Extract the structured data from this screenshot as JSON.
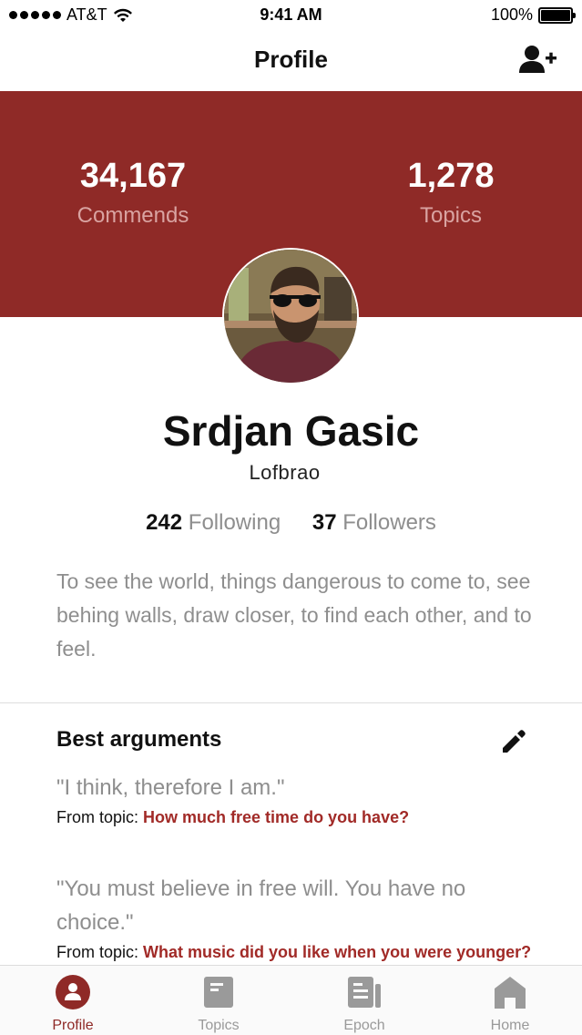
{
  "status_bar": {
    "carrier": "AT&T",
    "time": "9:41 AM",
    "battery": "100%",
    "battery_level": 1.0
  },
  "nav": {
    "title": "Profile",
    "action_icon": "add-user-icon"
  },
  "stats": {
    "commends_value": "34,167",
    "commends_label": "Commends",
    "topics_value": "1,278",
    "topics_label": "Topics"
  },
  "profile": {
    "name": "Srdjan Gasic",
    "username": "Lofbrao",
    "following_count": "242",
    "following_label": "Following",
    "followers_count": "37",
    "followers_label": "Followers",
    "bio": "To see the world, things dangerous to come to, see behing walls, draw closer, to find each other, and to feel."
  },
  "best_arguments": {
    "title": "Best arguments",
    "edit_icon": "pencil-icon",
    "items": [
      {
        "quote": "\"I think, therefore I am.\"",
        "source_prefix": "From topic: ",
        "topic": "How much free time do you have?"
      },
      {
        "quote": "\"You must believe in free will. You have no choice.\"",
        "source_prefix": "From topic: ",
        "topic": "What music did you like when you were younger?"
      }
    ]
  },
  "tabs": [
    {
      "label": "Profile",
      "icon": "profile-icon",
      "active": true
    },
    {
      "label": "Topics",
      "icon": "topics-icon",
      "active": false
    },
    {
      "label": "Epoch",
      "icon": "epoch-icon",
      "active": false
    },
    {
      "label": "Home",
      "icon": "home-icon",
      "active": false
    }
  ],
  "colors": {
    "accent": "#8f2a27",
    "topic_link": "#a12a27",
    "muted_text": "#8e8e8e",
    "stat_label": "#d9a3a1"
  }
}
